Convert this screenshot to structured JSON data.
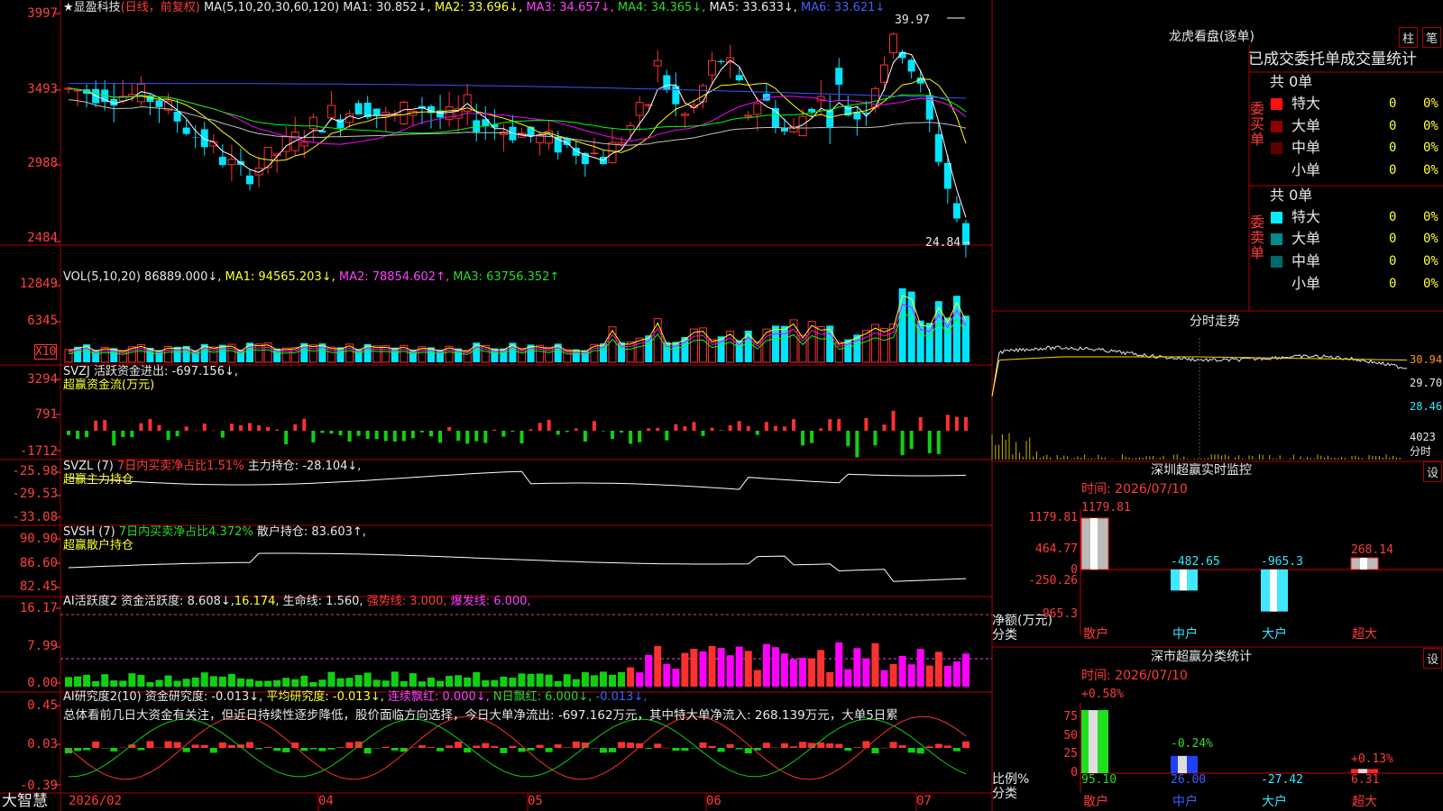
{
  "app": "大智慧",
  "stock": {
    "name": "显盈科技",
    "mode": "(日线，前复权)"
  },
  "colors": {
    "up": "#ff3030",
    "down": "#00e5ff",
    "grid": "#b00000",
    "ma1": "#ffffff",
    "ma2": "#ffff00",
    "ma3": "#ff00ff",
    "ma4": "#00ff00",
    "ma5": "#c0c0c0",
    "ma6": "#4050ff"
  },
  "kline": {
    "title": "MA(5,10,20,30,60,120)",
    "ma": [
      "MA1: 30.852↓,",
      "MA2: 33.696↓,",
      "MA3: 34.657↓,",
      "MA4: 34.365↓,",
      "MA5: 33.633↓,",
      "MA6: 33.621↓"
    ],
    "yticks": [
      "3997",
      "3493",
      "2988",
      "2484"
    ],
    "high_label": "39.97",
    "low_label": "24.84"
  },
  "vol": {
    "title": "VOL(5,10,20)",
    "value": "86889.000↓,",
    "ma": [
      "MA1: 94565.203↓,",
      "MA2: 78854.602↑,",
      "MA3: 63756.352↑"
    ],
    "yticks": [
      "12849",
      "6345"
    ],
    "unit": "X10"
  },
  "svzj": {
    "line1": "SVZJ  活跃资金进出: -697.156↓,",
    "line2": "超赢资金流(万元)",
    "yticks": [
      "3294",
      "791",
      "-1712"
    ]
  },
  "svzl": {
    "p1": "SVZL (7)",
    "p2": "7日内买卖净占比1.51%",
    "p3": "主力持仓: -28.104↓,",
    "line2": "超赢主力持仓",
    "yticks": [
      "-25.98",
      "-29.53",
      "-33.08"
    ]
  },
  "svsh": {
    "p1": "SVSH (7)",
    "p2": "7日内买卖净占比4.372%",
    "p3": "散户持仓: 83.603↑,",
    "line2": "超赢散户持仓",
    "yticks": [
      "90.90",
      "86.60",
      "82.45"
    ]
  },
  "ai2": {
    "p1": "AI活跃度2",
    "p2": "资金活跃度: 8.608↓,",
    "p3": "16.174,",
    "p4": "生命线: 1.560,",
    "p5": "强势线: 3.000,",
    "p6": "爆发线: 6.000,",
    "yticks": [
      "16.17",
      "7.99",
      "0.00"
    ]
  },
  "ai3": {
    "p1": "AI研究度2(10)",
    "p2": "资金研究度: -0.013↓,",
    "p3": "平均研究度: -0.013↓,",
    "p4": "连续飘红: 0.000↓,",
    "p5": "N日飘红: 6.000↓,",
    "p6": "-0.013↓,",
    "comment": "总体看前几日大资金有关注，但近日持续性逐步降低，股价面临方向选择，今日大单净流出: -697.162万元，其中特大单净流入: 268.139万元，大单5日累",
    "yticks": [
      "0.45",
      "0.03",
      "-0.39"
    ]
  },
  "xaxis": [
    "2026/02",
    "04",
    "05",
    "06",
    "07"
  ],
  "lhb": {
    "title": "龙虎看盘(逐单)",
    "btn1": "柱",
    "btn2": "笔",
    "header": "已成交委托单成交量统计",
    "buy": {
      "side": "委买单",
      "total": "共 0单",
      "rows": [
        {
          "name": "特大",
          "v": "0",
          "p": "0%"
        },
        {
          "name": "大单",
          "v": "0",
          "p": "0%"
        },
        {
          "name": "中单",
          "v": "0",
          "p": "0%"
        },
        {
          "name": "小单",
          "v": "0",
          "p": "0%"
        }
      ]
    },
    "sell": {
      "side": "委卖单",
      "total": "共 0单",
      "rows": [
        {
          "name": "特大",
          "v": "0",
          "p": "0%"
        },
        {
          "name": "大单",
          "v": "0",
          "p": "0%"
        },
        {
          "name": "中单",
          "v": "0",
          "p": "0%"
        },
        {
          "name": "小单",
          "v": "0",
          "p": "0%"
        }
      ]
    }
  },
  "fenshi": {
    "title": "分时走势",
    "yticks": [
      "30.94",
      "29.70",
      "28.46"
    ],
    "vol_label": "4023",
    "unit": "分时"
  },
  "monitor": {
    "title": "深圳超赢实时监控",
    "btn": "设",
    "time": "时间: 2026/07/10",
    "yticks": [
      "1179.81",
      "464.77",
      "0",
      "-250.26",
      "-965.3"
    ],
    "unit1": "净额(万元)",
    "unit2": "分类",
    "categories": [
      "散户",
      "中户",
      "大户",
      "超大"
    ],
    "chart_data": {
      "type": "bar",
      "categories": [
        "散户",
        "中户",
        "大户",
        "超大"
      ],
      "values": [
        1179.81,
        -482.65,
        -965.3,
        268.14
      ],
      "ylim": [
        -965.3,
        1179.81
      ]
    },
    "value_labels": [
      "1179.81",
      "-482.65",
      "-965.3",
      "268.14"
    ]
  },
  "classify": {
    "title": "深市超赢分类统计",
    "btn": "设",
    "time": "时间: 2026/07/10",
    "yticks": [
      "75",
      "50",
      "25",
      "0"
    ],
    "unit1": "比例%",
    "unit2": "分类",
    "categories": [
      "散户",
      "中户",
      "大户",
      "超大"
    ],
    "chart_data": {
      "type": "bar",
      "categories": [
        "散户",
        "中户",
        "大户",
        "超大"
      ],
      "values": [
        95.1,
        26.0,
        -27.42,
        6.31
      ],
      "changes": [
        "+0.58%",
        "-0.24%",
        "",
        "+0.13%"
      ]
    },
    "value_labels": [
      "95.10",
      "26.00",
      "-27.42",
      "6.31"
    ]
  }
}
